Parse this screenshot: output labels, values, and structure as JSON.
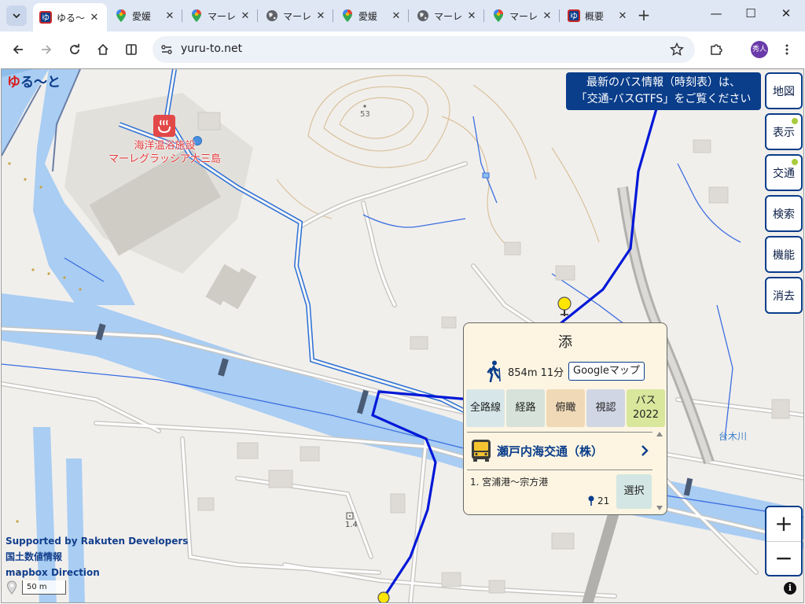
{
  "browser": {
    "tabs": [
      {
        "title": "ゆる〜",
        "icon": "yuruto-favicon",
        "active": true
      },
      {
        "title": "愛媛",
        "icon": "google-maps-favicon",
        "active": false
      },
      {
        "title": "マーレ",
        "icon": "google-maps-favicon",
        "active": false
      },
      {
        "title": "マーレ",
        "icon": "globe-favicon",
        "active": false
      },
      {
        "title": "愛媛",
        "icon": "google-maps-favicon",
        "active": false
      },
      {
        "title": "マーレ",
        "icon": "globe-favicon",
        "active": false
      },
      {
        "title": "マーレ",
        "icon": "google-maps-favicon",
        "active": false
      },
      {
        "title": "概要",
        "icon": "yuruto-favicon",
        "active": false
      }
    ],
    "url": "yuru-to.net",
    "profile_initials": "秀人"
  },
  "map": {
    "logo": {
      "part1": "ゆ",
      "part2": "る〜と"
    },
    "notice_line1": "最新のバス情報（時刻表）は、",
    "notice_line2": "「交通-バスGTFS」をご覧ください",
    "side_buttons": [
      {
        "label": "地図",
        "dot": false
      },
      {
        "label": "表示",
        "dot": true
      },
      {
        "label": "交通",
        "dot": true
      },
      {
        "label": "検索",
        "dot": false
      },
      {
        "label": "機能",
        "dot": false
      },
      {
        "label": "消去",
        "dot": false
      }
    ],
    "zoom_in": "+",
    "zoom_out": "−",
    "info": "i",
    "poi_line1": "海洋温浴施設",
    "poi_line2": "マーレグラッシア大三島",
    "river_label": "台木川",
    "hill_elevation": "53",
    "spot_elevation": "1.4",
    "credits": [
      "Supported by Rakuten Developers",
      "国土数値情報",
      "mapbox Direction"
    ],
    "scale_label": "50 m",
    "colors": {
      "route": "#0018d8",
      "road_outline": "#2a6fd6",
      "water": "#a9cdf3",
      "notice_bg": "#0a3d8a",
      "marker": "#ffe600"
    }
  },
  "popup": {
    "stop_name": "添",
    "walk_text": "854m 11分",
    "gmap_label": "Googleマップ",
    "options": [
      {
        "label": "全路線",
        "color": "#d7e7e9"
      },
      {
        "label": "経路",
        "color": "#d6e2da"
      },
      {
        "label": "俯瞰",
        "color": "#f0d9b6"
      },
      {
        "label": "視認",
        "color": "#d1d6e4"
      },
      {
        "label": "バス\n2022",
        "color": "#d9e79d"
      }
    ],
    "operator": "瀬戸内海交通（株）",
    "route": "1. 宮浦港〜宗方港",
    "stop_count": "21",
    "select_label": "選択"
  }
}
